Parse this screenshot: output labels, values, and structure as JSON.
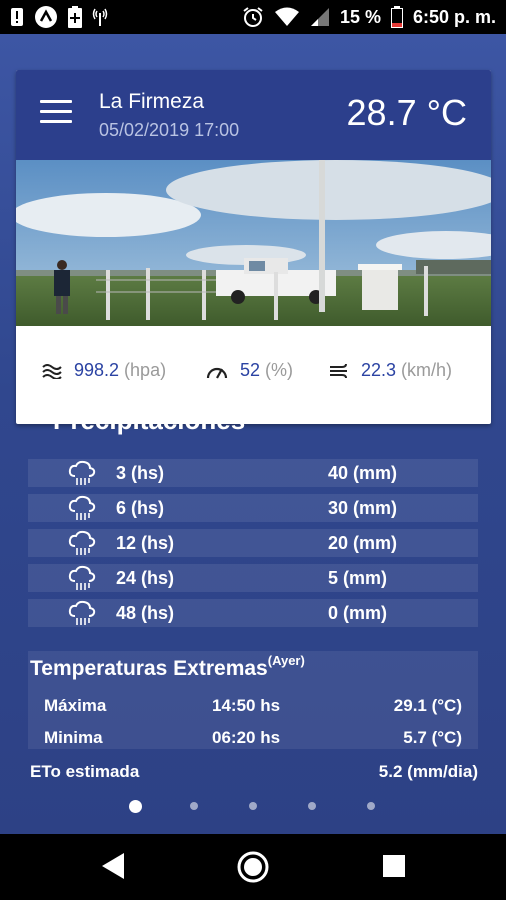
{
  "status_bar": {
    "battery_percent": "15 %",
    "time": "6:50 p. m."
  },
  "header": {
    "station_name": "La Firmeza",
    "datetime": "05/02/2019 17:00",
    "temperature": "28.7 °C"
  },
  "metrics": {
    "pressure": {
      "icon": "waves-icon",
      "value": "998.2",
      "unit": "(hpa)"
    },
    "humidity": {
      "icon": "gauge-icon",
      "value": "52",
      "unit": "(%)"
    },
    "wind": {
      "icon": "wind-icon",
      "value": "22.3",
      "unit": "(km/h)"
    }
  },
  "precipitation": {
    "title": "Precipitaciones",
    "rows": [
      {
        "hours": "3 (hs)",
        "mm": "40 (mm)"
      },
      {
        "hours": "6 (hs)",
        "mm": "30 (mm)"
      },
      {
        "hours": "12 (hs)",
        "mm": "20 (mm)"
      },
      {
        "hours": "24 (hs)",
        "mm": "5 (mm)"
      },
      {
        "hours": "48 (hs)",
        "mm": "0 (mm)"
      }
    ]
  },
  "extremes": {
    "title": "Temperaturas Extremas",
    "title_sup": "(Ayer)",
    "max": {
      "label": "Máxima",
      "time": "14:50 hs",
      "value": "29.1 (°C)"
    },
    "min": {
      "label": "Minima",
      "time": "06:20 hs",
      "value": "5.7 (°C)"
    }
  },
  "eto": {
    "label": "ETo estimada",
    "value": "5.2 (mm/dia)"
  },
  "pager": {
    "count": 5,
    "active": 0
  },
  "colors": {
    "header_blue": "#2c3f8c",
    "value_blue": "#2b43a3",
    "background_blue": "#30478e"
  }
}
